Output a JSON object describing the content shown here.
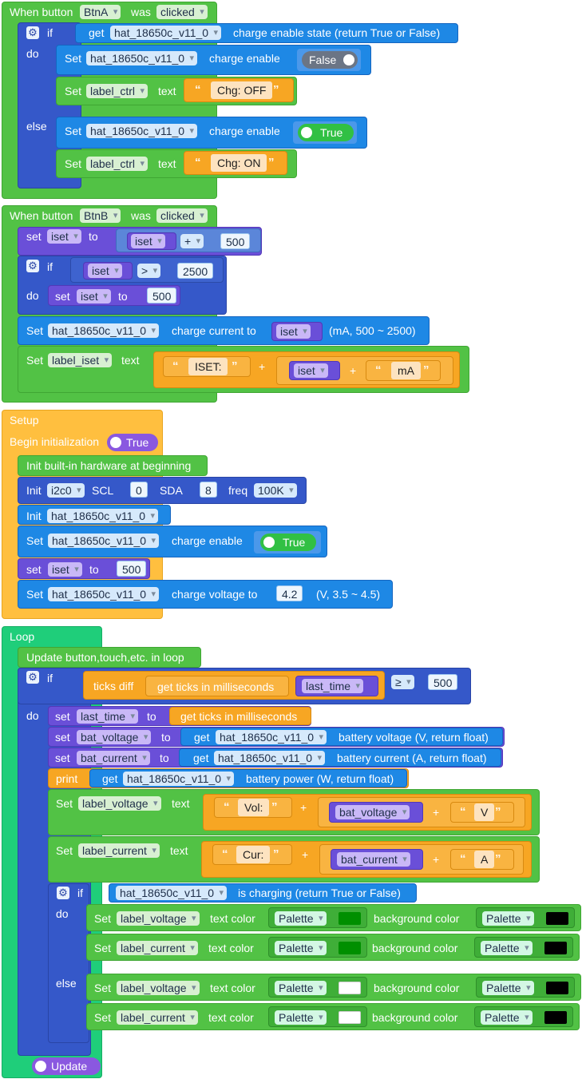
{
  "event_btna": {
    "label_when": "When button",
    "button": "BtnA",
    "label_was": "was",
    "event": "clicked",
    "if_label": "if",
    "do_label": "do",
    "else_label": "else",
    "get_label": "get",
    "device": "hat_18650c_v11_0",
    "get_charge_state": "charge enable state (return True or False)",
    "set_label": "Set",
    "charge_enable": "charge enable",
    "false_val": "False",
    "true_val": "True",
    "label_ctrl": "label_ctrl",
    "text_label": "text",
    "chg_off": "Chg: OFF",
    "chg_on": "Chg: ON"
  },
  "event_btnb": {
    "label_when": "When button",
    "button": "BtnB",
    "label_was": "was",
    "event": "clicked",
    "set_lower": "set",
    "to_label": "to",
    "var_iset": "iset",
    "op_plus": "+",
    "num_500": "500",
    "if_label": "if",
    "do_label": "do",
    "op_gt": ">",
    "num_2500": "2500",
    "set_label": "Set",
    "device": "hat_18650c_v11_0",
    "charge_current_to": "charge current to",
    "current_range": "(mA, 500 ~ 2500)",
    "label_iset": "label_iset",
    "text_label": "text",
    "str_iset": "ISET:",
    "str_ma": "mA"
  },
  "setup": {
    "title": "Setup",
    "begin_init": "Begin initialization",
    "begin_val": "True",
    "init_builtin": "Init built-in hardware at beginning",
    "init_label": "Init",
    "bus": "i2c0",
    "scl_label": "SCL",
    "scl_val": "0",
    "sda_label": "SDA",
    "sda_val": "8",
    "freq_label": "freq",
    "freq_val": "100K",
    "device": "hat_18650c_v11_0",
    "set_label": "Set",
    "charge_enable": "charge enable",
    "true_val": "True",
    "set_lower": "set",
    "var_iset": "iset",
    "to_label": "to",
    "iset_val": "500",
    "charge_voltage_to": "charge voltage to",
    "voltage_val": "4.2",
    "voltage_range": "(V, 3.5 ~ 4.5)"
  },
  "loop": {
    "title": "Loop",
    "update_label": "Update button,touch,etc. in loop",
    "if_label": "if",
    "do_label": "do",
    "else_label": "else",
    "ticks_diff": "ticks diff",
    "get_ticks": "get ticks in milliseconds",
    "var_last_time": "last_time",
    "op_ge": "≥",
    "num_500": "500",
    "set_lower": "set",
    "to_label": "to",
    "var_bat_voltage": "bat_voltage",
    "var_bat_current": "bat_current",
    "get_label": "get",
    "device": "hat_18650c_v11_0",
    "battery_voltage": "battery voltage (V, return float)",
    "battery_current": "battery current (A, return float)",
    "print_label": "print",
    "battery_power": "battery power (W, return float)",
    "set_label": "Set",
    "label_voltage": "label_voltage",
    "label_current": "label_current",
    "text_label": "text",
    "str_vol": "Vol:",
    "str_v": "V",
    "str_cur": "Cur:",
    "str_a": "A",
    "op_plus": "+",
    "is_charging": "is charging (return True or False)",
    "text_color": "text color",
    "background_color": "background color",
    "palette": "Palette",
    "update_toggle": "Update"
  },
  "colors": {
    "swatch_green": "#008f00",
    "swatch_black": "#000000",
    "swatch_white": "#ffffff"
  }
}
